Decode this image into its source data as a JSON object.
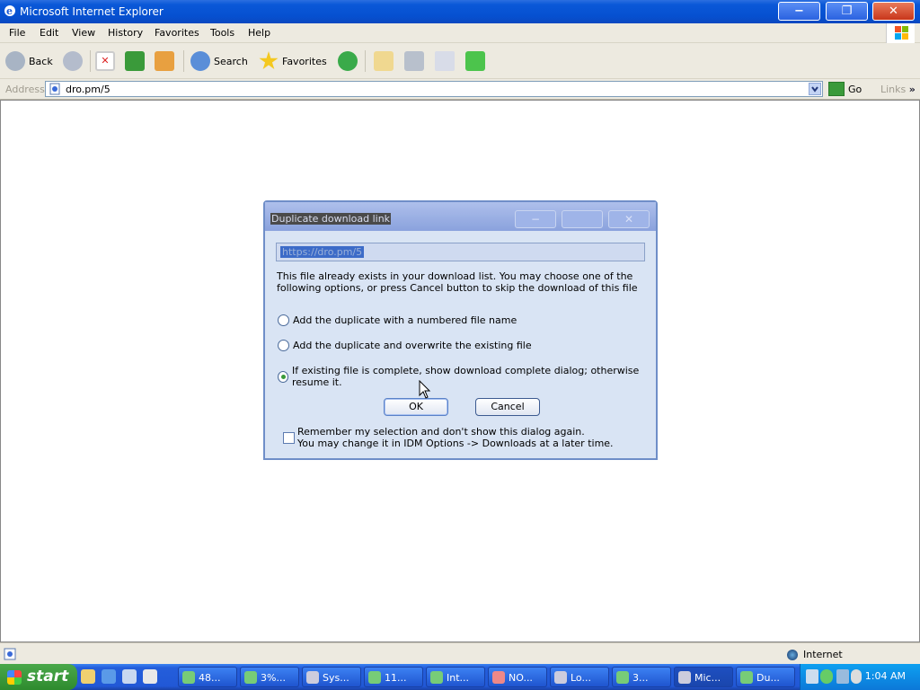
{
  "window": {
    "title": "Microsoft Internet Explorer",
    "minimize_glyph": "−",
    "restore_glyph": "❐",
    "close_glyph": "✕"
  },
  "menu": {
    "items": [
      "File",
      "Edit",
      "View",
      "History",
      "Favorites",
      "Tools",
      "Help"
    ]
  },
  "toolbar": {
    "back_label": "Back",
    "search_label": "Search",
    "favorites_label": "Favorites"
  },
  "address": {
    "label": "Address",
    "value": "dro.pm/5",
    "go_label": "Go",
    "links_label": "Links",
    "links_chevron": "»"
  },
  "status": {
    "zone": "Internet"
  },
  "taskbar": {
    "start_label": "start",
    "tasks": [
      "48...",
      "3%...",
      "Sys...",
      "11...",
      "Int...",
      "NO...",
      "Lo...",
      "3...",
      "Mic...",
      "Du..."
    ],
    "clock": "1:04 AM"
  },
  "dialog": {
    "title": "Duplicate download link",
    "url": "https://dro.pm/5",
    "message": "This file already exists in your download list. You may choose one of the following options, or press Cancel button to skip the download of this file",
    "options": [
      "Add the duplicate with a numbered file name",
      "Add the duplicate and overwrite the existing file",
      "If existing file is complete, show download complete dialog; otherwise resume it."
    ],
    "selected_option": 2,
    "ok_label": "OK",
    "cancel_label": "Cancel",
    "remember_line1": "Remember my selection and don't show this dialog again.",
    "remember_line2": "You may change it in IDM Options -> Downloads at a later time.",
    "remember_checked": false
  },
  "colors": {
    "titlebar": "#0a58d8",
    "taskbar": "#245edb",
    "start_green": "#3a9a3a",
    "dialog_bg": "#d9e4f4"
  }
}
